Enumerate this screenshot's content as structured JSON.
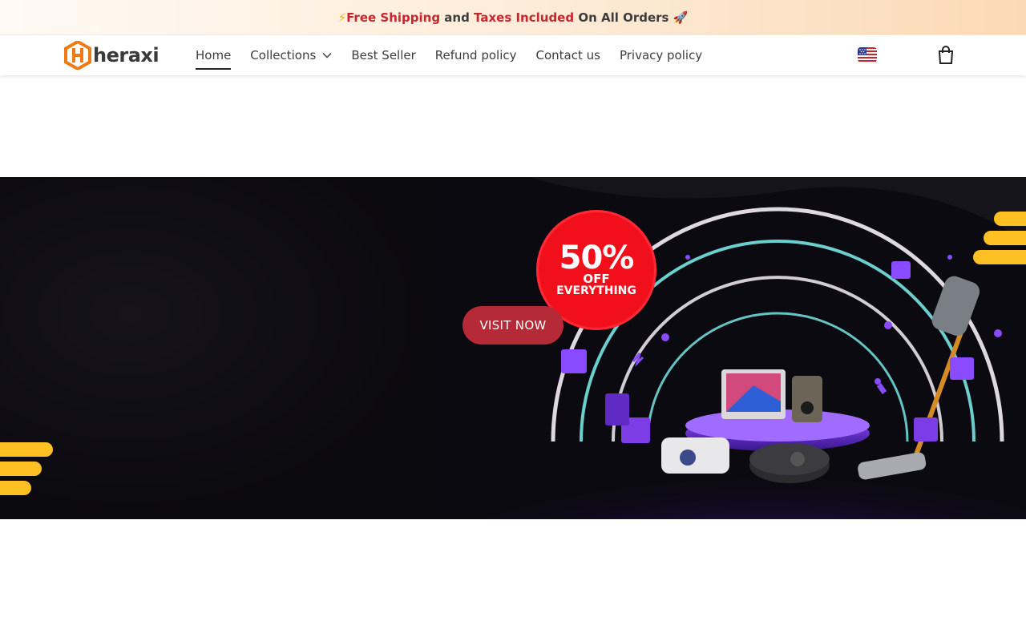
{
  "announcement": {
    "bolt": "⚡",
    "part1": "Free Shipping",
    "part2": " and ",
    "part3": "Taxes Included",
    "part4": " On All Orders ",
    "rocket": "🚀"
  },
  "header": {
    "brand": "heraxi",
    "nav": [
      {
        "label": "Home",
        "active": true
      },
      {
        "label": "Collections",
        "has_dropdown": true
      },
      {
        "label": "Best Seller"
      },
      {
        "label": "Refund policy"
      },
      {
        "label": "Contact us"
      },
      {
        "label": "Privacy policy"
      }
    ],
    "locale_icon": "us-flag-icon",
    "cart_icon": "shopping-bag-icon"
  },
  "hero": {
    "badge_percent": "50%",
    "badge_off": "OFF",
    "badge_everything": "EVERYTHING",
    "cta_label": "VISIT NOW"
  },
  "colors": {
    "accent_red": "#c8262f",
    "cta_red": "#b52a36",
    "badge_red": "#f20f1c",
    "stripe_yellow": "#ffc024",
    "logo_orange": "#f07a12"
  }
}
